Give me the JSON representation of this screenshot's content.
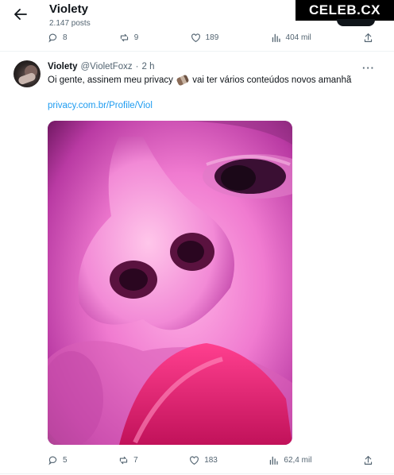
{
  "header": {
    "title": "Violety",
    "subtitle": "2.147 posts"
  },
  "brand": {
    "label": "CELEB.CX"
  },
  "prev_actions": {
    "replies": "8",
    "reposts": "9",
    "likes": "189",
    "views": "404 mil"
  },
  "tweet": {
    "name": "Violety",
    "handle": "@VioletFoxz",
    "dot": "·",
    "time": "2 h",
    "more": "···",
    "text_before": "Oi gente, assinem meu privacy",
    "text_after": "vai ter vários conteúdos novos amanhã",
    "link": "privacy.com.br/Profile/Viol",
    "actions": {
      "replies": "5",
      "reposts": "7",
      "likes": "183",
      "views": "62,4 mil"
    }
  },
  "colors": {
    "accent": "#1d9bf0",
    "muted": "#536471",
    "text": "#0f1419"
  },
  "icons": [
    "back-arrow-icon",
    "reply-icon",
    "repost-icon",
    "like-icon",
    "views-icon",
    "share-icon",
    "more-icon"
  ]
}
